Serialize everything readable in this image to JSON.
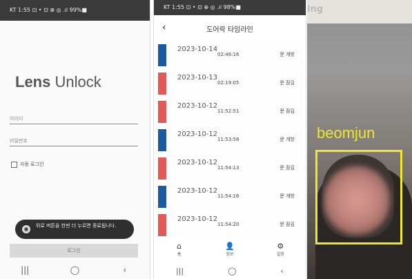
{
  "login": {
    "status_bar": "KT 1:55 ⊡ •     ⊡ ⊕ ◎ .ıl 99%■",
    "app_title_bold": "Lens",
    "app_title_rest": " Unlock",
    "id_placeholder": "아이디",
    "password_placeholder": "비밀번호",
    "auto_login_label": "자동 로그인",
    "toast_text": "뒤로 버튼을 한번 더 누르면 종료됩니다.",
    "login_button": "로그인",
    "nav_icons": [
      "|||",
      "◯",
      "‹"
    ]
  },
  "timeline": {
    "status_bar": "KT 1:55 ⊡ •     ⊡ ⊕ ◎ .ıl 98%■",
    "back_icon": "‹",
    "title": "도어락 타임라인",
    "entries": [
      {
        "date": "2023-10-14",
        "time": "02:46:16",
        "status": "문 개방",
        "color": "#1e5aa0"
      },
      {
        "date": "2023-10-13",
        "time": "02:19:05",
        "status": "문 잠김",
        "color": "#e05a5a"
      },
      {
        "date": "2023-10-12",
        "time": "11:52:51",
        "status": "문 잠김",
        "color": "#e05a5a"
      },
      {
        "date": "2023-10-12",
        "time": "11:53:58",
        "status": "문 개방",
        "color": "#1e5aa0"
      },
      {
        "date": "2023-10-12",
        "time": "11:54:13",
        "status": "문 잠김",
        "color": "#e05a5a"
      },
      {
        "date": "2023-10-12",
        "time": "11:54:16",
        "status": "문 개방",
        "color": "#1e5aa0"
      },
      {
        "date": "2023-10-12",
        "time": "11:54:20",
        "status": "문 잠김",
        "color": "#e05a5a"
      }
    ],
    "tabs": [
      {
        "icon": "⌂",
        "label": "홈"
      },
      {
        "icon": "👤",
        "label": "정보"
      },
      {
        "icon": "⚙",
        "label": "설정"
      }
    ],
    "nav_icons": [
      "|||",
      "◯",
      "‹"
    ]
  },
  "camera": {
    "top_text": "ing",
    "face_label": "beomjun"
  }
}
